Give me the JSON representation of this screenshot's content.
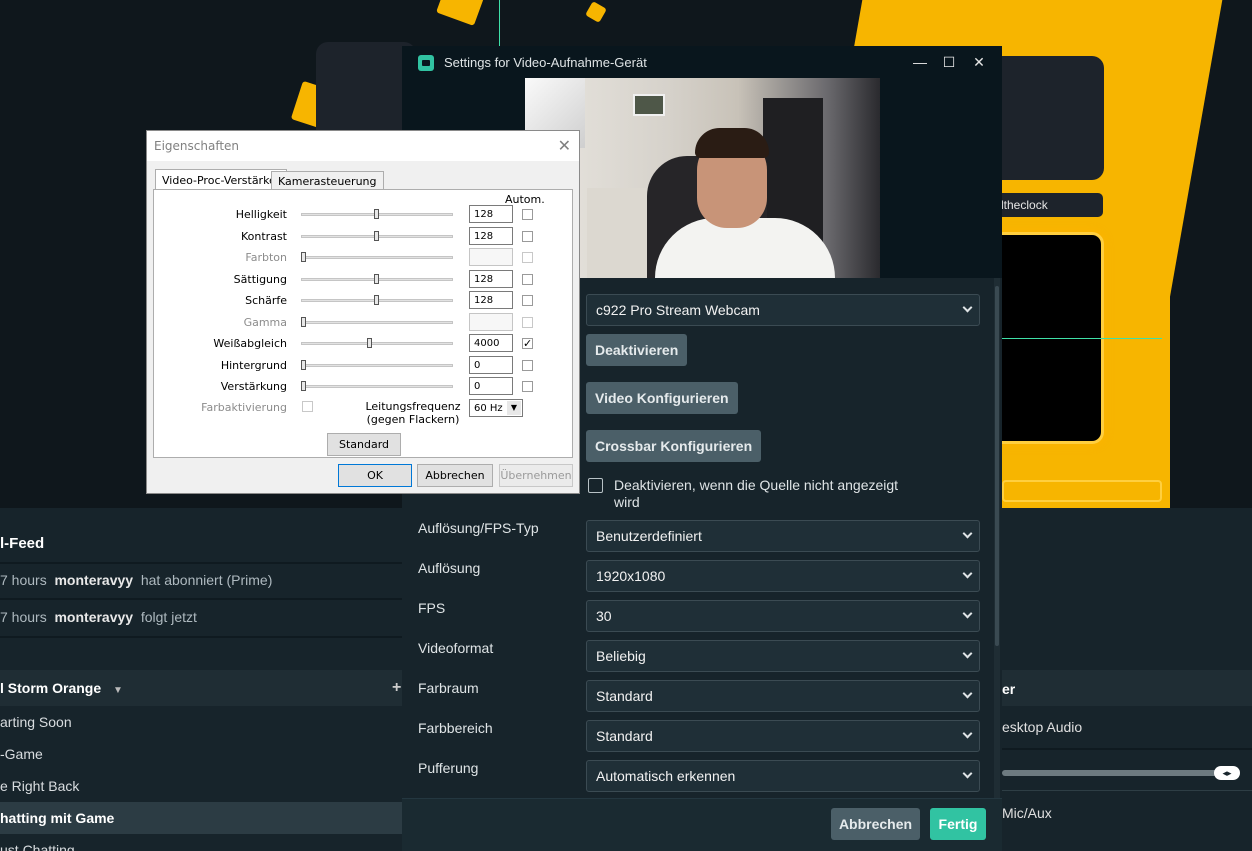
{
  "background": {
    "overlay_label": "ltheclock",
    "feed": {
      "title": "l-Feed",
      "rows": [
        {
          "time": "7 hours",
          "user": "monteravyy",
          "action": "hat abonniert (Prime)"
        },
        {
          "time": "7 hours",
          "user": "monteravyy",
          "action": "folgt jetzt"
        }
      ]
    },
    "scenes": {
      "collection": "l Storm Orange",
      "items": [
        "arting Soon",
        "-Game",
        "e Right Back",
        "hatting mit Game",
        "ust Chatting"
      ],
      "active_index": 3
    },
    "mixer": {
      "title": "er",
      "channels": [
        "esktop Audio",
        "Mic/Aux"
      ]
    }
  },
  "settings": {
    "title": "Settings for Video-Aufnahme-Gerät",
    "controls": {
      "minimize": "—",
      "maximize": "☐",
      "close": "✕"
    },
    "device": "c922 Pro Stream Webcam",
    "buttons": {
      "deactivate": "Deaktivieren",
      "configure_video": "Video Konfigurieren",
      "configure_crossbar": "Crossbar Konfigurieren"
    },
    "checkbox_label": "Deaktivieren, wenn die Quelle nicht angezeigt wird",
    "fields": [
      {
        "label": "Auflösung/FPS-Typ",
        "value": "Benutzerdefiniert"
      },
      {
        "label": "Auflösung",
        "value": "1920x1080"
      },
      {
        "label": "FPS",
        "value": "30"
      },
      {
        "label": "Videoformat",
        "value": "Beliebig"
      },
      {
        "label": "Farbraum",
        "value": "Standard"
      },
      {
        "label": "Farbbereich",
        "value": "Standard"
      },
      {
        "label": "Pufferung",
        "value": "Automatisch erkennen"
      }
    ],
    "footer": {
      "cancel": "Abbrechen",
      "done": "Fertig"
    }
  },
  "properties": {
    "title": "Eigenschaften",
    "close": "✕",
    "tabs": [
      "Video-Proc-Verstärker",
      "Kamerasteuerung"
    ],
    "autom_label": "Autom.",
    "rows": [
      {
        "label": "Helligkeit",
        "value": "128",
        "pos": 0.5,
        "enabled": true,
        "auto": false
      },
      {
        "label": "Kontrast",
        "value": "128",
        "pos": 0.5,
        "enabled": true,
        "auto": false
      },
      {
        "label": "Farbton",
        "value": "",
        "pos": 0.0,
        "enabled": false,
        "auto": false
      },
      {
        "label": "Sättigung",
        "value": "128",
        "pos": 0.5,
        "enabled": true,
        "auto": false
      },
      {
        "label": "Schärfe",
        "value": "128",
        "pos": 0.5,
        "enabled": true,
        "auto": false
      },
      {
        "label": "Gamma",
        "value": "",
        "pos": 0.0,
        "enabled": false,
        "auto": false
      },
      {
        "label": "Weißabgleich",
        "value": "4000",
        "pos": 0.45,
        "enabled": true,
        "auto": true
      },
      {
        "label": "Hintergrund",
        "value": "0",
        "pos": 0.0,
        "enabled": true,
        "auto": false
      },
      {
        "label": "Verstärkung",
        "value": "0",
        "pos": 0.0,
        "enabled": true,
        "auto": false
      }
    ],
    "color_enable_label": "Farbaktivierung",
    "frequency_label": "Leitungsfrequenz (gegen Flackern)",
    "frequency_value": "60 Hz",
    "standard_button": "Standard",
    "ok": "OK",
    "cancel": "Abbrechen",
    "apply": "Übernehmen"
  },
  "colors": {
    "accent": "#31c3a2",
    "brand_yellow": "#f7b500",
    "panel": "#17242b"
  }
}
